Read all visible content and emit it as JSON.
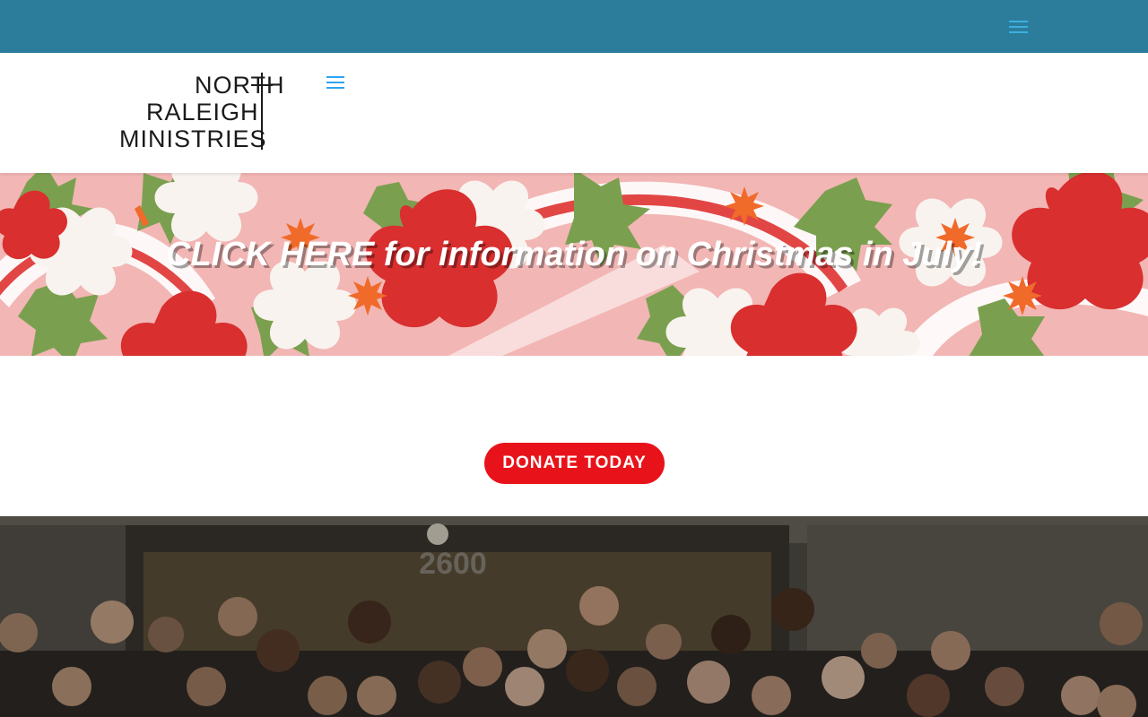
{
  "topbar": {
    "menu_icon": "hamburger-menu-icon"
  },
  "logo": {
    "line1": "NORTH",
    "line2": "RALEIGH",
    "line3": "MINISTRIES"
  },
  "header": {
    "menu_icon": "hamburger-menu-icon"
  },
  "hero": {
    "link_text": "CLICK HERE for information on Christmas in July!"
  },
  "donate": {
    "label": "DONATE TODAY"
  },
  "photo": {
    "sign_text": "2600"
  },
  "colors": {
    "topbar": "#2b7d9b",
    "menu_icon": "#2ea3f2",
    "donate_button": "#e8131a"
  }
}
